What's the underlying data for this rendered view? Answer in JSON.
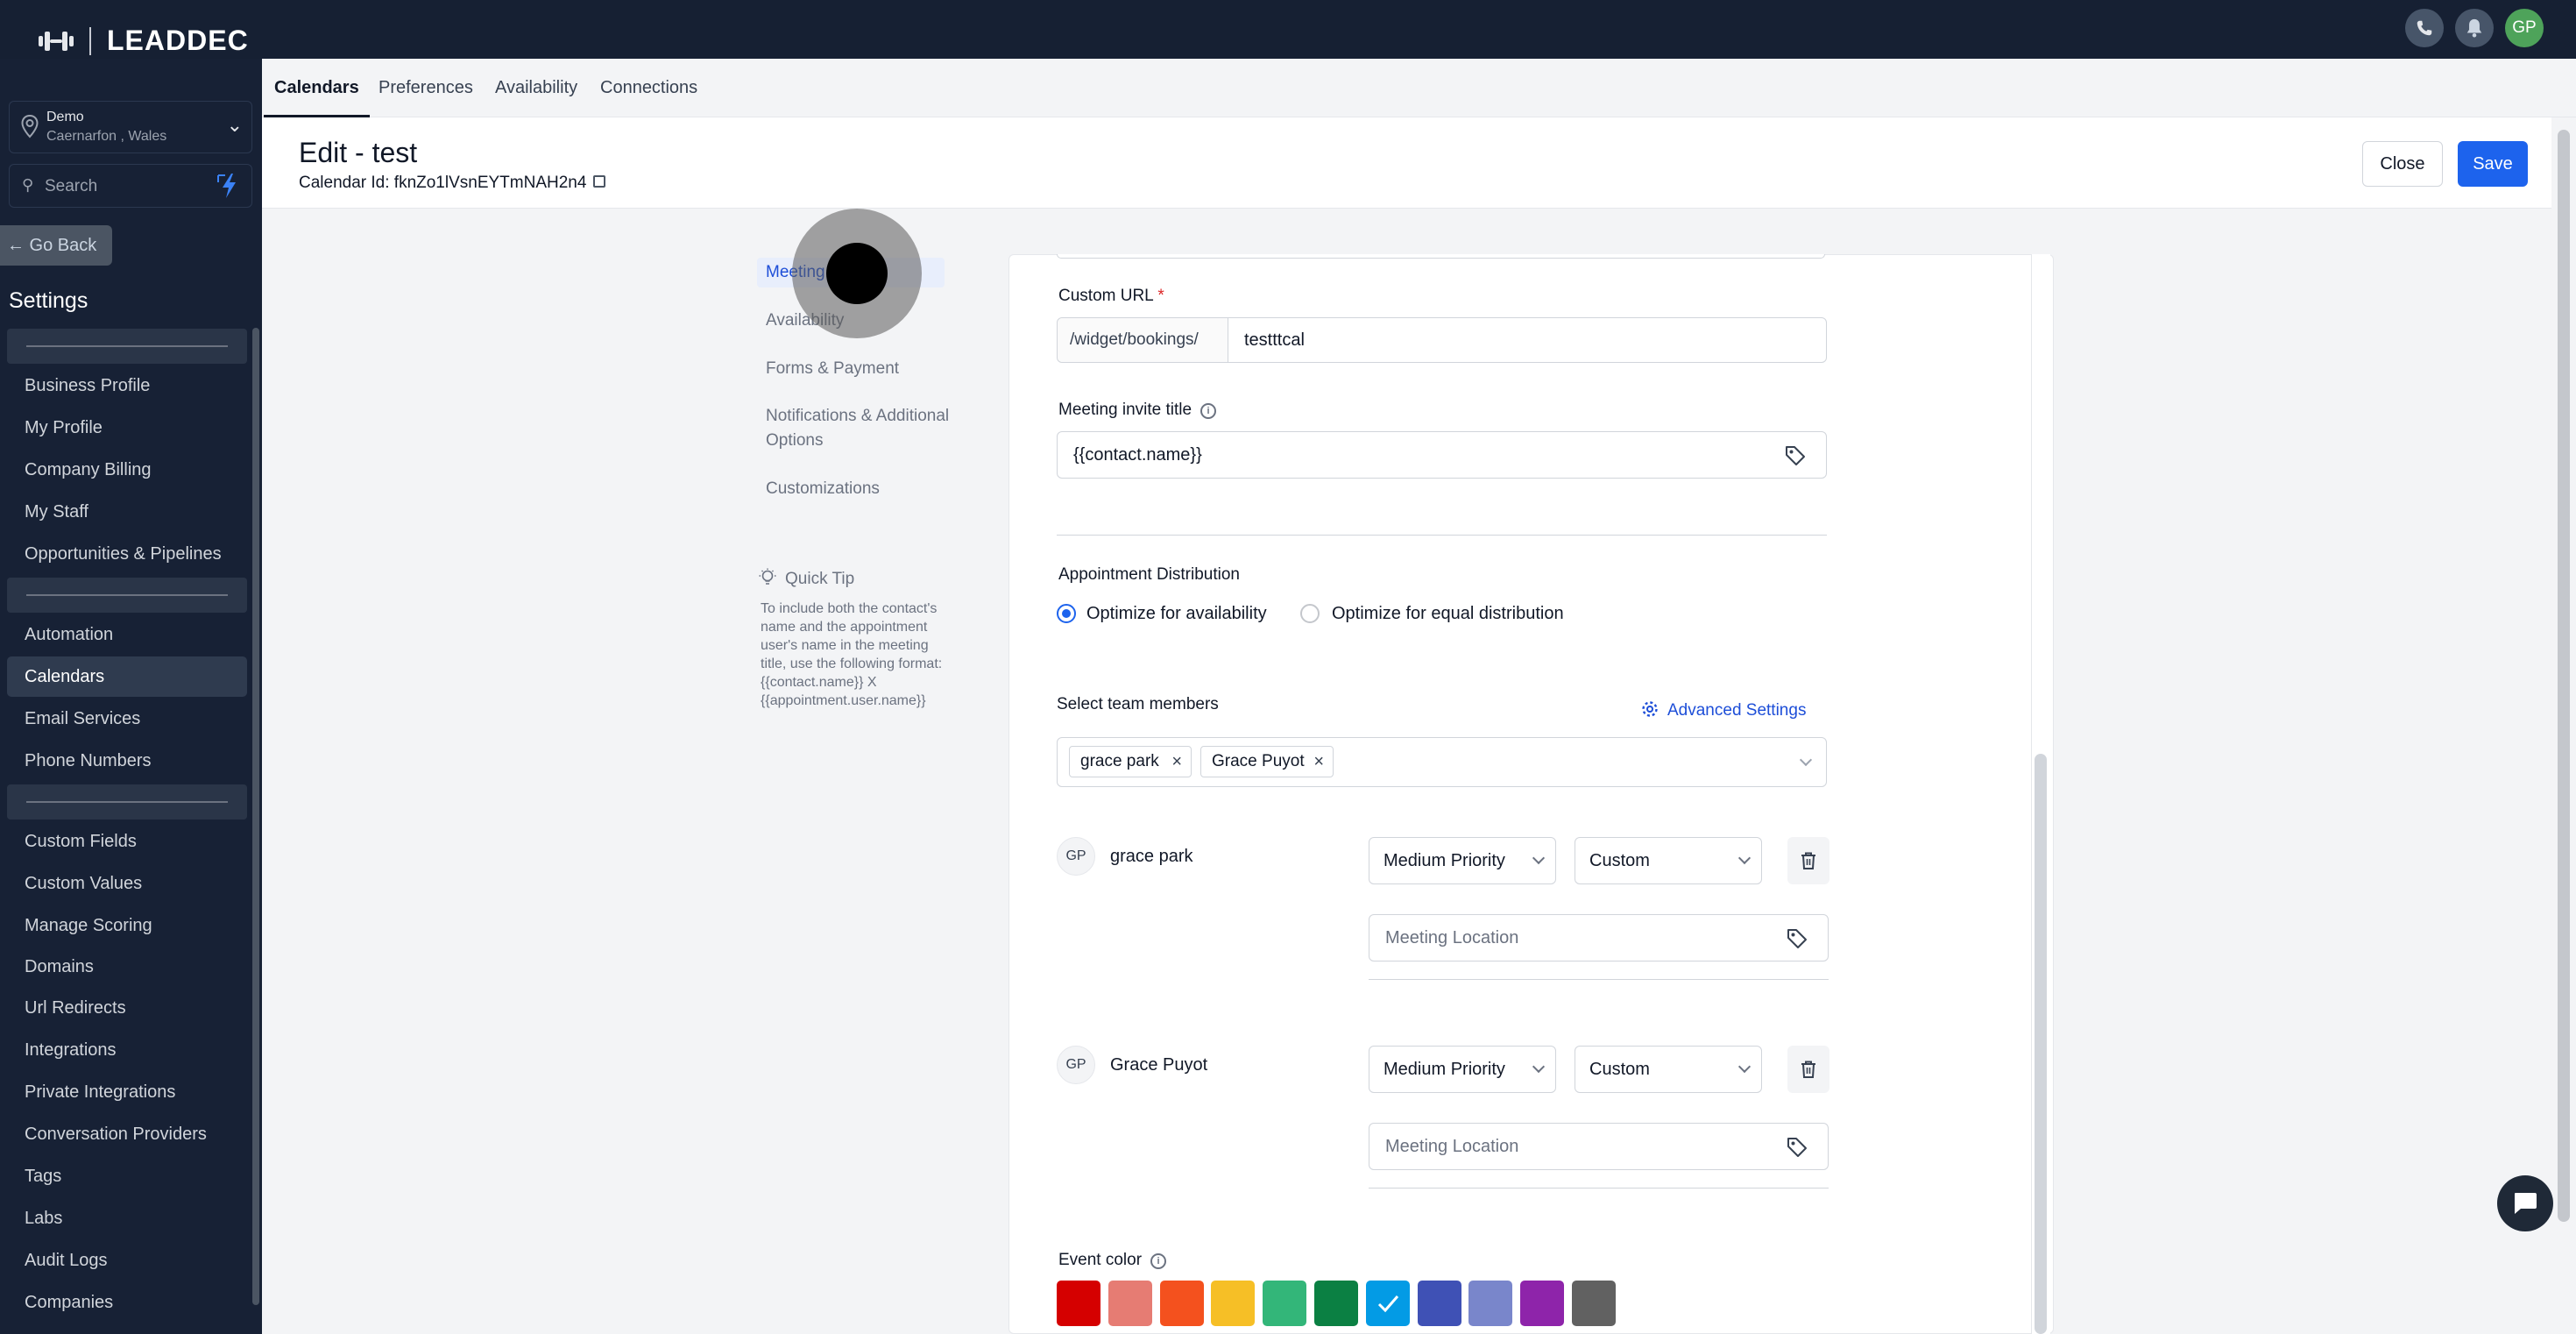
{
  "brand": {
    "name": "LEADDEC"
  },
  "topbar": {
    "avatar_initials": "GP"
  },
  "sidebar": {
    "location": {
      "name": "Demo",
      "place": "Caernarfon , Wales"
    },
    "search_placeholder": "Search",
    "go_back": "← Go Back",
    "settings_title": "Settings",
    "items": [
      "Business Profile",
      "My Profile",
      "Company Billing",
      "My Staff",
      "Opportunities & Pipelines",
      "Automation",
      "Calendars",
      "Email Services",
      "Phone Numbers",
      "Custom Fields",
      "Custom Values",
      "Manage Scoring",
      "Domains",
      "Url Redirects",
      "Integrations",
      "Private Integrations",
      "Conversation Providers",
      "Tags",
      "Labs",
      "Audit Logs",
      "Companies"
    ]
  },
  "tabs": [
    "Calendars",
    "Preferences",
    "Availability",
    "Connections"
  ],
  "header": {
    "title": "Edit - test",
    "calendar_id": "Calendar Id: fknZo1lVsnEYTmNAH2n4",
    "close_label": "Close",
    "save_label": "Save"
  },
  "subnav": {
    "items": [
      "Meeting",
      "Availability",
      "Forms & Payment",
      "Notifications & Additional Options",
      "Customizations"
    ],
    "tip_title": "Quick Tip",
    "tip_text": "To include both the contact's name and the appointment user's name in the meeting title, use the following format: {{contact.name}} X {{appointment.user.name}}"
  },
  "form": {
    "custom_url_label": "Custom URL",
    "required_mark": "*",
    "url_prefix": "/widget/bookings/",
    "url_value": "testttcal",
    "invite_title_label": "Meeting invite title",
    "invite_title_value": "{{contact.name}}",
    "distribution_label": "Appointment Distribution",
    "dist_options": [
      "Optimize for availability",
      "Optimize for equal distribution"
    ],
    "dist_selected": "Optimize for availability",
    "team_label": "Select team members",
    "advanced_settings": "Advanced Settings",
    "chips": [
      "grace park",
      "Grace Puyot"
    ],
    "members": [
      {
        "initials": "GP",
        "name": "grace park",
        "priority": "Medium Priority",
        "schedule": "Custom",
        "location_placeholder": "Meeting Location"
      },
      {
        "initials": "GP",
        "name": "Grace Puyot",
        "priority": "Medium Priority",
        "schedule": "Custom",
        "location_placeholder": "Meeting Location"
      }
    ],
    "event_color_label": "Event color",
    "colors": [
      "#d50000",
      "#e67c73",
      "#f4511e",
      "#f6bf26",
      "#33b679",
      "#0b8043",
      "#039be5",
      "#3f51b5",
      "#7986cb",
      "#8e24aa",
      "#616161"
    ],
    "selected_color": "#039be5"
  }
}
